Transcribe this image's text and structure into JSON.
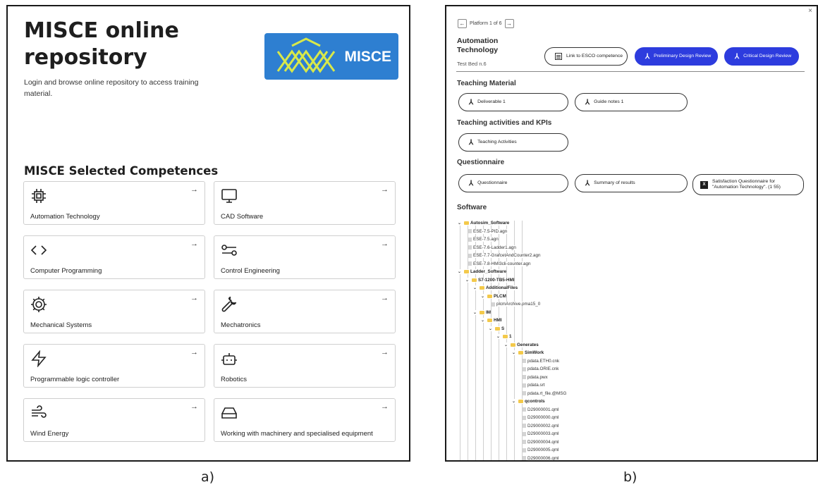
{
  "panel_a": {
    "title": "MISCE online repository",
    "description": "Login and browse online repository to access training material.",
    "logo_text": "MISCE",
    "selected_title": "MISCE Selected Competences",
    "competences": [
      {
        "label": "Automation Technology",
        "icon": "chip-icon"
      },
      {
        "label": "CAD Software",
        "icon": "monitor-icon"
      },
      {
        "label": "Computer Programming",
        "icon": "code-icon"
      },
      {
        "label": "Control Engineering",
        "icon": "sliders-icon"
      },
      {
        "label": "Mechanical Systems",
        "icon": "gear-icon"
      },
      {
        "label": "Mechatronics",
        "icon": "wrench-icon"
      },
      {
        "label": "Programmable logic controller",
        "icon": "lightning-icon"
      },
      {
        "label": "Robotics",
        "icon": "robot-icon"
      },
      {
        "label": "Wind Energy",
        "icon": "wind-icon"
      },
      {
        "label": "Working with machinery and specialised equipment",
        "icon": "hard-drive-icon"
      }
    ],
    "arrow": "→"
  },
  "panel_b": {
    "pager": {
      "prev": "←",
      "text": "Platform 1 of 6",
      "next": "→"
    },
    "close": "×",
    "title": "Automation Technology",
    "testbed": "Test Bed n.6",
    "header_buttons": {
      "esco": "Link to ESCO competence",
      "pdr": "Preliminary Design Review",
      "cdr": "Critical Design Review"
    },
    "teaching_material": {
      "heading": "Teaching Material",
      "items": [
        "Deliverable 1",
        "Guide notes 1"
      ]
    },
    "activities": {
      "heading": "Teaching activities and KPIs",
      "items": [
        "Teaching Activities"
      ]
    },
    "questionnaire": {
      "heading": "Questionnaire",
      "items": [
        "Questionnaire",
        "Summary of results"
      ],
      "satisfaction": "Satisfaction Questionnaire for \"Automation Technology\". (1 55)"
    },
    "software": {
      "heading": "Software",
      "tree": [
        {
          "label": "Autosim_Software",
          "type": "folder",
          "depth": 0
        },
        {
          "label": "ESE-7.5-PID.agn",
          "type": "file",
          "depth": 1
        },
        {
          "label": "ESE-7.5.agn",
          "type": "file",
          "depth": 1
        },
        {
          "label": "ESE-7.6-Ladder1.agn",
          "type": "file",
          "depth": 1
        },
        {
          "label": "ESE-7.7-GrafcetAndCounter2.agn",
          "type": "file",
          "depth": 1
        },
        {
          "label": "ESE-7.8-HMI3cli-counter.agn",
          "type": "file",
          "depth": 1
        },
        {
          "label": "Ladder_Software",
          "type": "folder",
          "depth": 0
        },
        {
          "label": "S7-1200-TB5-HMI",
          "type": "folder",
          "depth": 1
        },
        {
          "label": "AdditionalFiles",
          "type": "folder",
          "depth": 2
        },
        {
          "label": "PLCM",
          "type": "folder",
          "depth": 3
        },
        {
          "label": "plcmArchive.pma15_0",
          "type": "file",
          "depth": 4
        },
        {
          "label": "IM",
          "type": "folder",
          "depth": 2
        },
        {
          "label": "HMI",
          "type": "folder",
          "depth": 3
        },
        {
          "label": "S",
          "type": "folder",
          "depth": 4
        },
        {
          "label": "1",
          "type": "folder",
          "depth": 5
        },
        {
          "label": "Generates",
          "type": "folder",
          "depth": 6
        },
        {
          "label": "SimWork",
          "type": "folder",
          "depth": 7
        },
        {
          "label": "pdata.ETH0.cnk",
          "type": "file",
          "depth": 8
        },
        {
          "label": "pdata.ORIE.cnk",
          "type": "file",
          "depth": 8
        },
        {
          "label": "pdata.pwx",
          "type": "file",
          "depth": 8
        },
        {
          "label": "pdata.srt",
          "type": "file",
          "depth": 8
        },
        {
          "label": "pdata.rt_file.@MSG",
          "type": "file",
          "depth": 8
        },
        {
          "label": "qcontrols",
          "type": "folder",
          "depth": 7
        },
        {
          "label": "D29000001.qml",
          "type": "file",
          "depth": 8
        },
        {
          "label": "D29000000.qml",
          "type": "file",
          "depth": 8
        },
        {
          "label": "D29000002.qml",
          "type": "file",
          "depth": 8
        },
        {
          "label": "D29000003.qml",
          "type": "file",
          "depth": 8
        },
        {
          "label": "D29000004.qml",
          "type": "file",
          "depth": 8
        },
        {
          "label": "D29000005.qml",
          "type": "file",
          "depth": 8
        },
        {
          "label": "D29000006.qml",
          "type": "file",
          "depth": 8
        }
      ]
    }
  },
  "captions": {
    "a": "a)",
    "b": "b)"
  },
  "colors": {
    "logo_blue": "#2e7fd1",
    "button_blue": "#2d3cde",
    "folder_yellow": "#f3c94b"
  }
}
